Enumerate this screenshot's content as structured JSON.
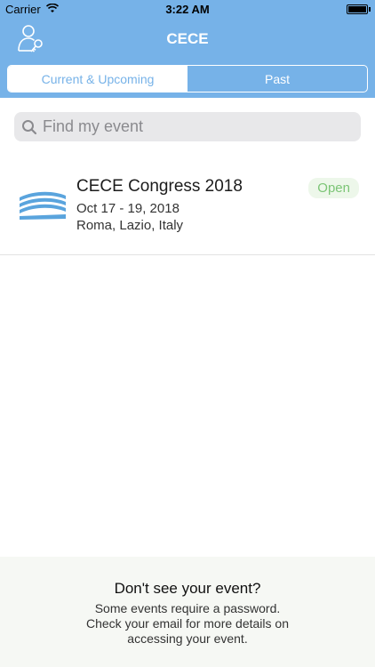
{
  "status_bar": {
    "carrier": "Carrier",
    "time": "3:22 AM"
  },
  "nav": {
    "title": "CECE",
    "left_icon": "user-key-icon"
  },
  "tabs": {
    "items": [
      {
        "label": "Current & Upcoming",
        "active": true
      },
      {
        "label": "Past",
        "active": false
      }
    ]
  },
  "search": {
    "placeholder": "Find my event",
    "value": ""
  },
  "events": [
    {
      "name": "CECE Congress 2018",
      "dates": "Oct 17 - 19, 2018",
      "location": "Roma, Lazio, Italy",
      "status": "Open"
    }
  ],
  "footer": {
    "title": "Don't see your event?",
    "text": "Some events require a password. Check your email for more details on accessing your event."
  },
  "colors": {
    "accent": "#76b2e8",
    "open_badge_text": "#7cc576",
    "open_badge_bg": "#edf7ea",
    "footer_bg": "#f6f8f4"
  }
}
